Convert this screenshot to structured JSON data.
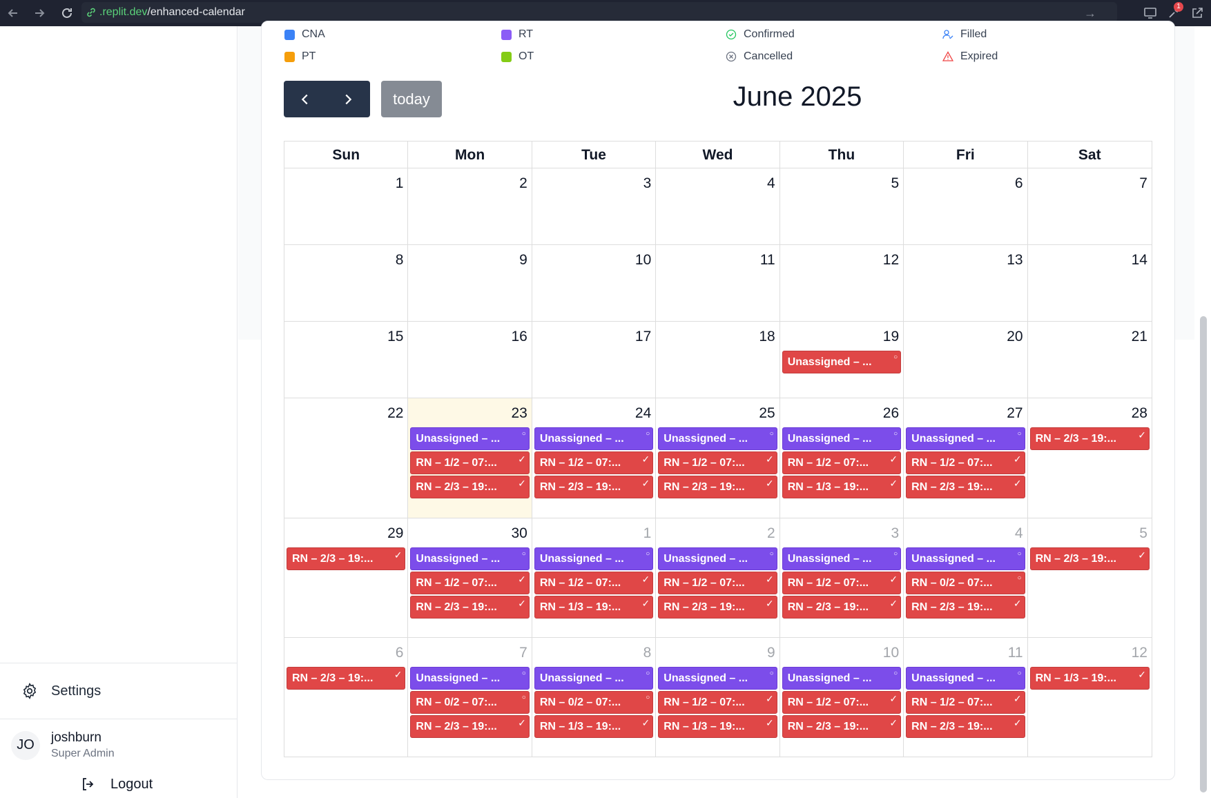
{
  "browser": {
    "url_domain": ".replit.dev",
    "url_path": "/enhanced-calendar",
    "badge_count": "1"
  },
  "sidebar": {
    "settings_label": "Settings",
    "user_initials": "JO",
    "user_name": "joshburn",
    "user_role": "Super Admin",
    "logout_label": "Logout"
  },
  "legend": {
    "roles": [
      {
        "label": "CNA",
        "color": "#3b82f6"
      },
      {
        "label": "RT",
        "color": "#8b5cf6"
      },
      {
        "label": "PT",
        "color": "#f59e0b"
      },
      {
        "label": "OT",
        "color": "#84cc16"
      }
    ],
    "statuses": [
      {
        "label": "Confirmed",
        "icon": "check-circle-icon",
        "color": "#22c55e"
      },
      {
        "label": "Cancelled",
        "icon": "x-circle-icon",
        "color": "#6b7280"
      },
      {
        "label": "Filled",
        "icon": "user-check-icon",
        "color": "#3b82f6"
      },
      {
        "label": "Expired",
        "icon": "warning-triangle-icon",
        "color": "#ef4444"
      }
    ]
  },
  "toolbar": {
    "prev_icon": "chevron-left-icon",
    "next_icon": "chevron-right-icon",
    "today_label": "today",
    "title": "June 2025"
  },
  "calendar": {
    "day_headers": [
      "Sun",
      "Mon",
      "Tue",
      "Wed",
      "Thu",
      "Fri",
      "Sat"
    ],
    "weeks": [
      {
        "days": [
          {
            "num": "1",
            "other": false,
            "events": []
          },
          {
            "num": "2",
            "other": false,
            "events": []
          },
          {
            "num": "3",
            "other": false,
            "events": []
          },
          {
            "num": "4",
            "other": false,
            "events": []
          },
          {
            "num": "5",
            "other": false,
            "events": []
          },
          {
            "num": "6",
            "other": false,
            "events": []
          },
          {
            "num": "7",
            "other": false,
            "events": []
          }
        ]
      },
      {
        "days": [
          {
            "num": "8",
            "other": false,
            "events": []
          },
          {
            "num": "9",
            "other": false,
            "events": []
          },
          {
            "num": "10",
            "other": false,
            "events": []
          },
          {
            "num": "11",
            "other": false,
            "events": []
          },
          {
            "num": "12",
            "other": false,
            "events": []
          },
          {
            "num": "13",
            "other": false,
            "events": []
          },
          {
            "num": "14",
            "other": false,
            "events": []
          }
        ]
      },
      {
        "days": [
          {
            "num": "15",
            "other": false,
            "events": []
          },
          {
            "num": "16",
            "other": false,
            "events": []
          },
          {
            "num": "17",
            "other": false,
            "events": []
          },
          {
            "num": "18",
            "other": false,
            "events": []
          },
          {
            "num": "19",
            "other": false,
            "events": [
              {
                "text": "Unassigned – ...",
                "color": "red",
                "status": "○"
              }
            ]
          },
          {
            "num": "20",
            "other": false,
            "events": []
          },
          {
            "num": "21",
            "other": false,
            "events": []
          }
        ]
      },
      {
        "days": [
          {
            "num": "22",
            "other": false,
            "events": []
          },
          {
            "num": "23",
            "other": false,
            "today": true,
            "events": [
              {
                "text": "Unassigned – ...",
                "color": "purple",
                "status": "○"
              },
              {
                "text": "RN – 1/2 – 07:...",
                "color": "red",
                "status": "✓"
              },
              {
                "text": "RN – 2/3 – 19:...",
                "color": "red",
                "status": "✓"
              }
            ]
          },
          {
            "num": "24",
            "other": false,
            "events": [
              {
                "text": "Unassigned – ...",
                "color": "purple",
                "status": "○"
              },
              {
                "text": "RN – 1/2 – 07:...",
                "color": "red",
                "status": "✓"
              },
              {
                "text": "RN – 2/3 – 19:...",
                "color": "red",
                "status": "✓"
              }
            ]
          },
          {
            "num": "25",
            "other": false,
            "events": [
              {
                "text": "Unassigned – ...",
                "color": "purple",
                "status": "○"
              },
              {
                "text": "RN – 1/2 – 07:...",
                "color": "red",
                "status": "✓"
              },
              {
                "text": "RN – 2/3 – 19:...",
                "color": "red",
                "status": "✓"
              }
            ]
          },
          {
            "num": "26",
            "other": false,
            "events": [
              {
                "text": "Unassigned – ...",
                "color": "purple",
                "status": "○"
              },
              {
                "text": "RN – 1/2 – 07:...",
                "color": "red",
                "status": "✓"
              },
              {
                "text": "RN – 1/3 – 19:...",
                "color": "red",
                "status": "✓"
              }
            ]
          },
          {
            "num": "27",
            "other": false,
            "events": [
              {
                "text": "Unassigned – ...",
                "color": "purple",
                "status": "○"
              },
              {
                "text": "RN – 1/2 – 07:...",
                "color": "red",
                "status": "✓"
              },
              {
                "text": "RN – 2/3 – 19:...",
                "color": "red",
                "status": "✓"
              }
            ]
          },
          {
            "num": "28",
            "other": false,
            "events": [
              {
                "text": "RN – 2/3 – 19:...",
                "color": "red",
                "status": "✓"
              }
            ]
          }
        ]
      },
      {
        "days": [
          {
            "num": "29",
            "other": false,
            "events": [
              {
                "text": "RN – 2/3 – 19:...",
                "color": "red",
                "status": "✓"
              }
            ]
          },
          {
            "num": "30",
            "other": false,
            "events": [
              {
                "text": "Unassigned – ...",
                "color": "purple",
                "status": "○"
              },
              {
                "text": "RN – 1/2 – 07:...",
                "color": "red",
                "status": "✓"
              },
              {
                "text": "RN – 2/3 – 19:...",
                "color": "red",
                "status": "✓"
              }
            ]
          },
          {
            "num": "1",
            "other": true,
            "events": [
              {
                "text": "Unassigned – ...",
                "color": "purple",
                "status": "○"
              },
              {
                "text": "RN – 1/2 – 07:...",
                "color": "red",
                "status": "✓"
              },
              {
                "text": "RN – 1/3 – 19:...",
                "color": "red",
                "status": "✓"
              }
            ]
          },
          {
            "num": "2",
            "other": true,
            "events": [
              {
                "text": "Unassigned – ...",
                "color": "purple",
                "status": "○"
              },
              {
                "text": "RN – 1/2 – 07:...",
                "color": "red",
                "status": "✓"
              },
              {
                "text": "RN – 2/3 – 19:...",
                "color": "red",
                "status": "✓"
              }
            ]
          },
          {
            "num": "3",
            "other": true,
            "events": [
              {
                "text": "Unassigned – ...",
                "color": "purple",
                "status": "○"
              },
              {
                "text": "RN – 1/2 – 07:...",
                "color": "red",
                "status": "✓"
              },
              {
                "text": "RN – 2/3 – 19:...",
                "color": "red",
                "status": "✓"
              }
            ]
          },
          {
            "num": "4",
            "other": true,
            "events": [
              {
                "text": "Unassigned – ...",
                "color": "purple",
                "status": "○"
              },
              {
                "text": "RN – 0/2 – 07:...",
                "color": "red",
                "status": "○"
              },
              {
                "text": "RN – 2/3 – 19:...",
                "color": "red",
                "status": "✓"
              }
            ]
          },
          {
            "num": "5",
            "other": true,
            "events": [
              {
                "text": "RN – 2/3 – 19:...",
                "color": "red",
                "status": "✓"
              }
            ]
          }
        ]
      },
      {
        "days": [
          {
            "num": "6",
            "other": true,
            "events": [
              {
                "text": "RN – 2/3 – 19:...",
                "color": "red",
                "status": "✓"
              }
            ]
          },
          {
            "num": "7",
            "other": true,
            "events": [
              {
                "text": "Unassigned – ...",
                "color": "purple",
                "status": "○"
              },
              {
                "text": "RN – 0/2 – 07:...",
                "color": "red",
                "status": "○"
              },
              {
                "text": "RN – 2/3 – 19:...",
                "color": "red",
                "status": "✓"
              }
            ]
          },
          {
            "num": "8",
            "other": true,
            "events": [
              {
                "text": "Unassigned – ...",
                "color": "purple",
                "status": "○"
              },
              {
                "text": "RN – 0/2 – 07:...",
                "color": "red",
                "status": "○"
              },
              {
                "text": "RN – 1/3 – 19:...",
                "color": "red",
                "status": "✓"
              }
            ]
          },
          {
            "num": "9",
            "other": true,
            "events": [
              {
                "text": "Unassigned – ...",
                "color": "purple",
                "status": "○"
              },
              {
                "text": "RN – 1/2 – 07:...",
                "color": "red",
                "status": "✓"
              },
              {
                "text": "RN – 1/3 – 19:...",
                "color": "red",
                "status": "✓"
              }
            ]
          },
          {
            "num": "10",
            "other": true,
            "events": [
              {
                "text": "Unassigned – ...",
                "color": "purple",
                "status": "○"
              },
              {
                "text": "RN – 1/2 – 07:...",
                "color": "red",
                "status": "✓"
              },
              {
                "text": "RN – 2/3 – 19:...",
                "color": "red",
                "status": "✓"
              }
            ]
          },
          {
            "num": "11",
            "other": true,
            "events": [
              {
                "text": "Unassigned – ...",
                "color": "purple",
                "status": "○"
              },
              {
                "text": "RN – 1/2 – 07:...",
                "color": "red",
                "status": "✓"
              },
              {
                "text": "RN – 2/3 – 19:...",
                "color": "red",
                "status": "✓"
              }
            ]
          },
          {
            "num": "12",
            "other": true,
            "events": [
              {
                "text": "RN – 1/3 – 19:...",
                "color": "red",
                "status": "✓"
              }
            ]
          }
        ]
      }
    ]
  }
}
